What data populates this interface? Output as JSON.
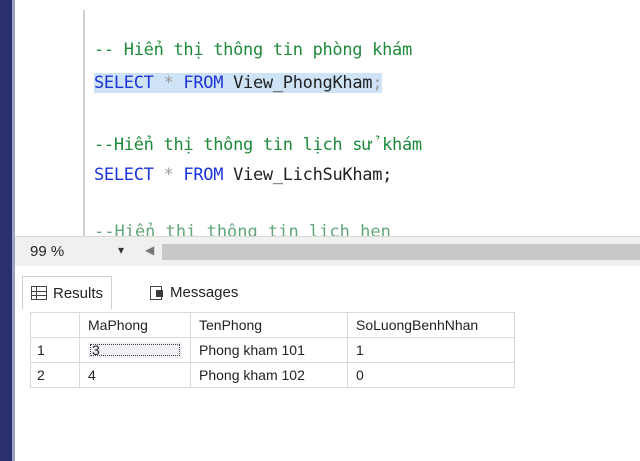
{
  "editor": {
    "line1_comment": "-- Hiển thị thông tin phòng khám",
    "line2": {
      "select": "SELECT",
      "star": "*",
      "from": "FROM",
      "object": "View_PhongKham",
      "semi": ";"
    },
    "line3_comment": "--Hiển thị thông tin lịch sử khám",
    "line4": {
      "select": "SELECT",
      "star": "*",
      "from": "FROM",
      "object": "View_LichSuKham",
      "semi": ";"
    },
    "line5_partial": "--Hiển thị thông tin lịch hẹn"
  },
  "status": {
    "zoom": "99 %",
    "dropdown_icon": "▾",
    "scroll_left_icon": "◀"
  },
  "tabs": {
    "results": "Results",
    "messages": "Messages"
  },
  "results": {
    "columns": [
      "MaPhong",
      "TenPhong",
      "SoLuongBenhNhan"
    ],
    "rows": [
      {
        "num": "1",
        "cells": [
          "3",
          "Phong kham 101",
          "1"
        ]
      },
      {
        "num": "2",
        "cells": [
          "4",
          "Phong kham 102",
          "0"
        ]
      }
    ]
  },
  "colors": {
    "keyword": "#1b35d8",
    "comment": "#1f8a3b",
    "selection": "#cfe3f7"
  }
}
